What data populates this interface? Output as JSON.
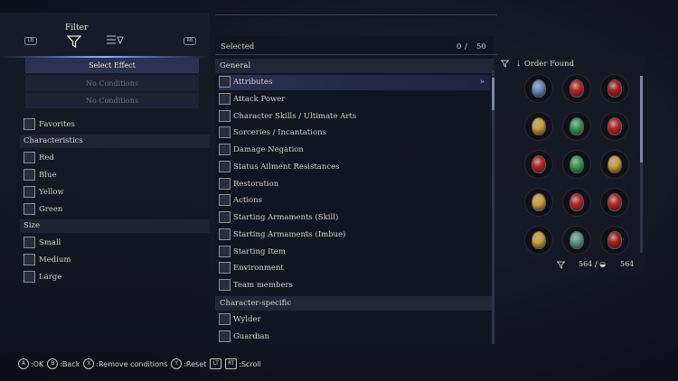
{
  "filter": {
    "title": "Filter",
    "left_bumper": "LB",
    "right_bumper": "RB",
    "select_effect": "Select Effect",
    "no_conditions_1": "No Conditions",
    "no_conditions_2": "No Conditions"
  },
  "left_options": {
    "favorites": "Favorites",
    "characteristics_header": "Characteristics",
    "red": "Red",
    "blue": "Blue",
    "yellow": "Yellow",
    "green": "Green",
    "size_header": "Size",
    "small": "Small",
    "medium": "Medium",
    "large": "Large"
  },
  "center": {
    "selected_label": "Selected",
    "selected_count": "0",
    "selected_max": "50",
    "general_header": "General",
    "items": [
      "Attributes",
      "Attack Power",
      "Character Skills / Ultimate Arts",
      "Sorceries / Incantations",
      "Damage Negation",
      "Status Ailment Resistances",
      "Restoration",
      "Actions",
      "Starting Armaments (Skill)",
      "Starting Armaments (Imbue)",
      "Starting Item",
      "Environment",
      "Team members"
    ],
    "character_header": "Character-specific",
    "char_items": [
      "Wylder",
      "Guardian"
    ]
  },
  "right": {
    "order_label": "Order Found",
    "count_left": "564",
    "count_right": "564"
  },
  "gems": [
    [
      "#6a8ac0",
      "#c02020",
      "#b01818"
    ],
    [
      "#d0a030",
      "#30a050",
      "#c02020"
    ],
    [
      "#c02020",
      "#30a050",
      "#d0a030"
    ],
    [
      "#d0a030",
      "#c02020",
      "#c02020"
    ],
    [
      "#d0a030",
      "#5a9a90",
      "#b01818"
    ]
  ],
  "footer": {
    "ok": ":OK",
    "back": ":Back",
    "remove": ":Remove conditions",
    "reset": ":Reset",
    "scroll": ":Scroll",
    "a": "A",
    "b": "B",
    "x": "X",
    "y": "Y",
    "lt": "LT",
    "rt": "RT"
  }
}
